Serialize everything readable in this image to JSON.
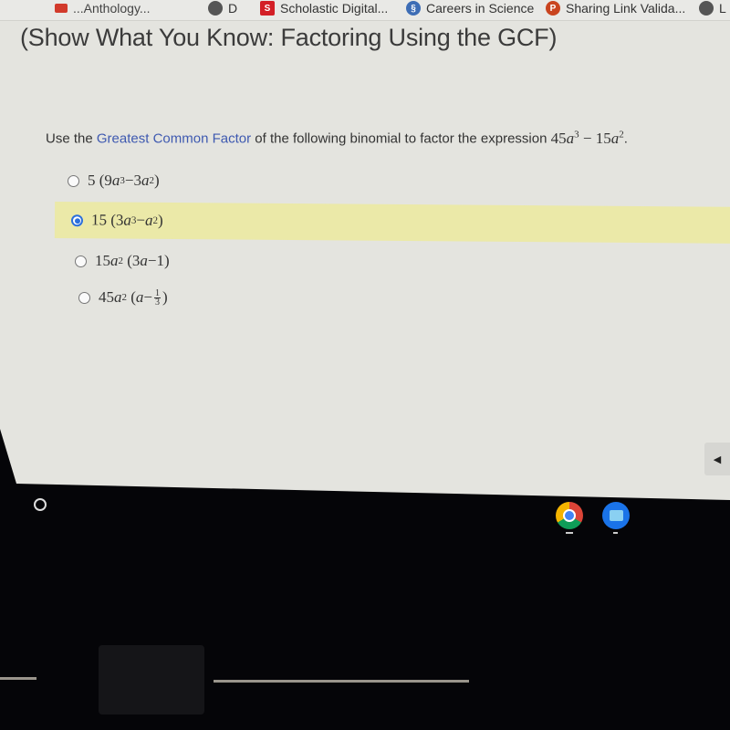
{
  "bookmarks": [
    {
      "label": "...Anthology...",
      "icon": "red-square-icon",
      "color": "#d23a2b"
    },
    {
      "label": "D",
      "icon": "globe-icon",
      "color": "#555555"
    },
    {
      "label": "Scholastic Digital...",
      "icon": "scholastic-s-icon",
      "color": "#d31f26",
      "glyph": "S"
    },
    {
      "label": "Careers in Science",
      "icon": "dna-icon",
      "color": "#3d6db5",
      "glyph": "§"
    },
    {
      "label": "Sharing Link Valida...",
      "icon": "powerpoint-icon",
      "color": "#c9441f",
      "glyph": "P"
    },
    {
      "label": "L",
      "icon": "globe-icon",
      "color": "#555555"
    }
  ],
  "page": {
    "title": "(Show What You Know: Factoring Using the GCF)"
  },
  "question": {
    "prefix": "Use the ",
    "link": "Greatest Common Factor",
    "suffix": " of the following binomial to factor the expression ",
    "expression": {
      "c1": "45",
      "v1": "a",
      "e1": "3",
      "op": " − ",
      "c2": "15",
      "v2": "a",
      "e2": "2"
    },
    "end": "."
  },
  "options": [
    {
      "coef": "5",
      "inner_a": "9",
      "inner_a_var": "a",
      "inner_a_exp": "3",
      "op": " − ",
      "inner_b": "3",
      "inner_b_var": "a",
      "inner_b_exp": "2",
      "selected": false
    },
    {
      "coef": "15",
      "inner_a": "3",
      "inner_a_var": "a",
      "inner_a_exp": "3",
      "op": " − ",
      "inner_b": "",
      "inner_b_var": "a",
      "inner_b_exp": "2",
      "selected": true
    },
    {
      "coef": "15",
      "coef_var": "a",
      "coef_exp": "2",
      "inner_a": "3",
      "inner_a_var": "a",
      "op": " − ",
      "inner_b": "1",
      "selected": false
    },
    {
      "coef": "45",
      "coef_var": "a",
      "coef_exp": "2",
      "inner_a_var": "a",
      "op": " − ",
      "frac_num": "1",
      "frac_den": "3",
      "selected": false
    }
  ],
  "side_tab": {
    "icon": "collapse-left-icon",
    "glyph": "◀"
  },
  "shelf": {
    "launcher_icon": "launcher-icon",
    "apps": [
      "chrome-icon",
      "files-icon"
    ]
  },
  "colors": {
    "link": "#3e59b0",
    "selected_row": "#ebe9a8",
    "radio_selected": "#2b6fdc"
  }
}
